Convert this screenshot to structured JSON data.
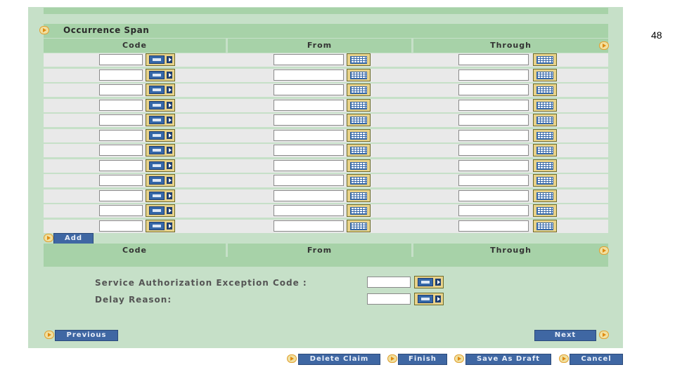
{
  "page_number": "48",
  "section": {
    "title": "Occurrence Span"
  },
  "columns": {
    "code": "Code",
    "from": "From",
    "through": "Through"
  },
  "rows": [
    {
      "code": "",
      "from": "",
      "through": ""
    },
    {
      "code": "",
      "from": "",
      "through": ""
    },
    {
      "code": "",
      "from": "",
      "through": ""
    },
    {
      "code": "",
      "from": "",
      "through": ""
    },
    {
      "code": "",
      "from": "",
      "through": ""
    },
    {
      "code": "",
      "from": "",
      "through": ""
    },
    {
      "code": "",
      "from": "",
      "through": ""
    },
    {
      "code": "",
      "from": "",
      "through": ""
    },
    {
      "code": "",
      "from": "",
      "through": ""
    },
    {
      "code": "",
      "from": "",
      "through": ""
    },
    {
      "code": "",
      "from": "",
      "through": ""
    },
    {
      "code": "",
      "from": "",
      "through": ""
    }
  ],
  "add_button": "Add",
  "fields": {
    "service_auth_label": "Service Authorization Exception Code :",
    "service_auth_value": "",
    "delay_reason_label": "Delay Reason:",
    "delay_reason_value": ""
  },
  "nav": {
    "previous": "Previous",
    "next": "Next"
  },
  "actions": {
    "delete_claim": "Delete Claim",
    "finish": "Finish",
    "save_as_draft": "Save As Draft",
    "cancel": "Cancel"
  },
  "colors": {
    "panel": "#c6e0c8",
    "header": "#a7d2a8",
    "row": "#e9e9e9",
    "button": "#3f67a3"
  }
}
